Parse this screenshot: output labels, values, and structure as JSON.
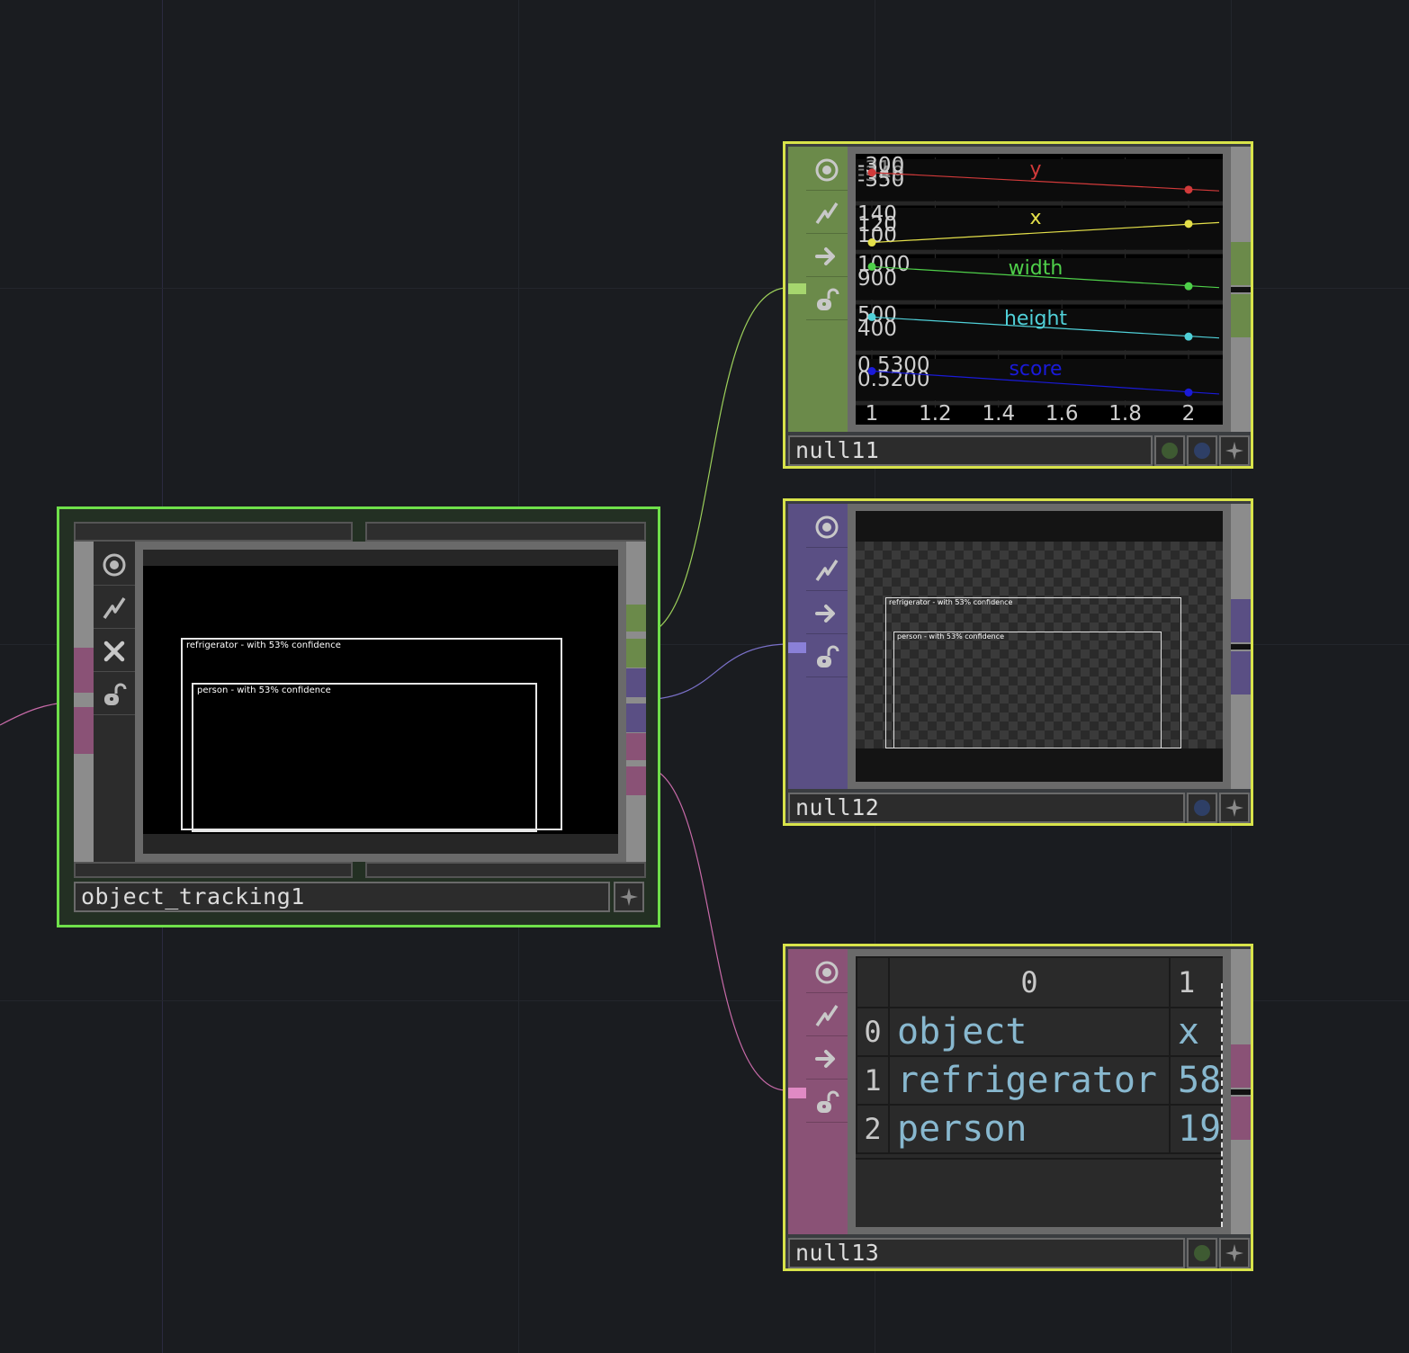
{
  "network": {
    "operators": [
      {
        "name": "object_tracking1",
        "selected": true
      },
      {
        "name": "null11"
      },
      {
        "name": "null12"
      },
      {
        "name": "null13"
      }
    ]
  },
  "tools": {
    "viewer": "viewer-toggle-icon",
    "bypass": "bypass-icon",
    "cook": "cook-arrow-icon",
    "lock": "lock-icon",
    "close": "close-icon",
    "pin": "pin-icon"
  },
  "object_tracking1": {
    "name": "object_tracking1",
    "detections": [
      {
        "label": "refrigerator - with 53% confidence"
      },
      {
        "label": "person - with 53% confidence"
      }
    ]
  },
  "null11": {
    "name": "null11",
    "chart_data": {
      "type": "line",
      "x": [
        1,
        2
      ],
      "xlim": [
        1,
        2
      ],
      "xticks": [
        "1",
        "1.2",
        "1.4",
        "1.6",
        "1.8",
        "2"
      ],
      "series": [
        {
          "name": "y",
          "color": "#d23a3a",
          "values": [
            -310,
            -345
          ],
          "ylim": [
            -360,
            -290
          ],
          "ticks": [
            "-300",
            "-350"
          ],
          "extra_ticks": [
            "-310",
            "-340"
          ]
        },
        {
          "name": "x",
          "color": "#e4e04a",
          "values": [
            100,
            130
          ],
          "ylim": [
            95,
            150
          ],
          "ticks": [
            "140",
            "120",
            "100"
          ]
        },
        {
          "name": "width",
          "color": "#4fd04a",
          "values": [
            1000,
            920
          ],
          "ylim": [
            880,
            1020
          ],
          "ticks": [
            "1000",
            "900"
          ]
        },
        {
          "name": "height",
          "color": "#50d0d8",
          "values": [
            500,
            420
          ],
          "ylim": [
            380,
            520
          ],
          "ticks": [
            "500",
            "400"
          ]
        },
        {
          "name": "score",
          "color": "#1a1ad8",
          "values": [
            0.53,
            0.52
          ],
          "ylim": [
            0.518,
            0.534
          ],
          "ticks": [
            "0.5300",
            "0.5200"
          ]
        }
      ]
    }
  },
  "null12": {
    "name": "null12",
    "detections": [
      {
        "label": "refrigerator - with 53% confidence"
      },
      {
        "label": "person - with 53% confidence"
      }
    ]
  },
  "null13": {
    "name": "null13",
    "table": {
      "col_headers": [
        "0",
        "1"
      ],
      "rows": [
        {
          "index": "0",
          "c0": "object",
          "c1": "x"
        },
        {
          "index": "1",
          "c0": "refrigerator",
          "c1": "58"
        },
        {
          "index": "2",
          "c0": "person",
          "c1": "19"
        }
      ]
    }
  },
  "colors": {
    "selected_border": "#6fe04a",
    "node_border": "#d8e34a",
    "chop_color": "#6b8a4a",
    "top_color": "#5a4f84",
    "dat_color": "#8a5276"
  }
}
